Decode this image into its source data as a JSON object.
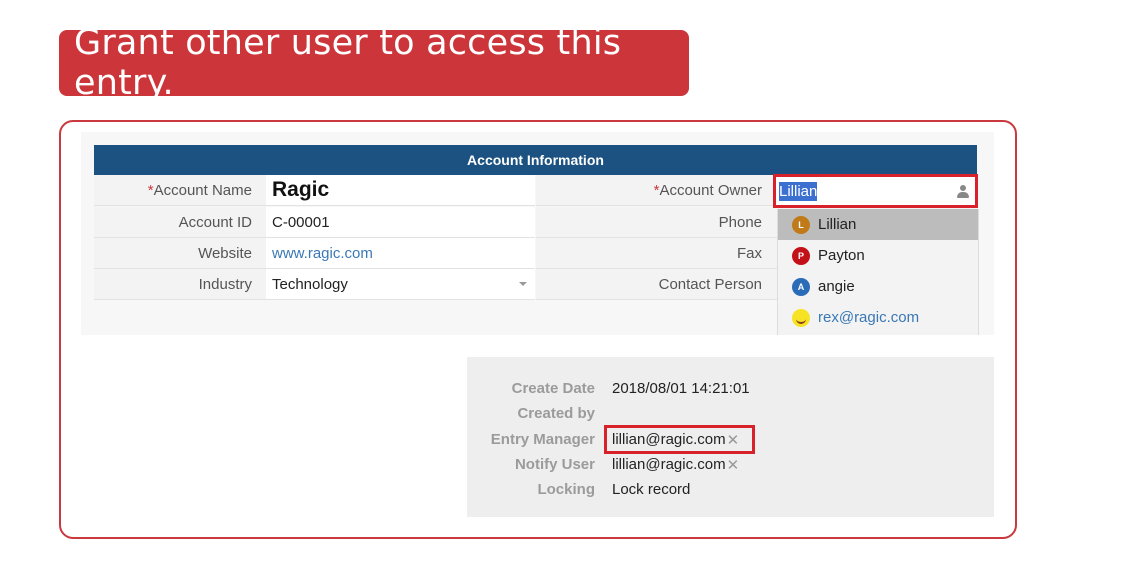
{
  "banner": {
    "title": "Grant other user to access this entry."
  },
  "form": {
    "section_title": "Account Information",
    "required_mark": "*",
    "left_fields": [
      {
        "label": "Account Name",
        "value": "Ragic",
        "required": true
      },
      {
        "label": "Account ID",
        "value": "C-00001"
      },
      {
        "label": "Website",
        "value": "www.ragic.com"
      },
      {
        "label": "Industry",
        "value": "Technology"
      }
    ],
    "right_fields": [
      {
        "label": "Account Owner",
        "value": "Lillian",
        "required": true
      },
      {
        "label": "Phone",
        "value": ""
      },
      {
        "label": "Fax",
        "value": ""
      },
      {
        "label": "Contact Person",
        "value": ""
      }
    ],
    "owner_dropdown": [
      {
        "initial": "L",
        "name": "Lillian",
        "color": "#c07a1a"
      },
      {
        "initial": "P",
        "name": "Payton",
        "color": "#c3111a"
      },
      {
        "initial": "A",
        "name": "angie",
        "color": "#2b6cb8"
      },
      {
        "initial": "",
        "name": "rex@ragic.com",
        "color": "#f7e223"
      }
    ]
  },
  "info": {
    "rows": [
      {
        "label": "Create Date",
        "value": "2018/08/01 14:21:01"
      },
      {
        "label": "Created by",
        "value": ""
      },
      {
        "label": "Entry Manager",
        "value": "lillian@ragic.com"
      },
      {
        "label": "Notify User",
        "value": "lillian@ragic.com"
      },
      {
        "label": "Locking",
        "value": "Lock record"
      }
    ],
    "remove_glyph": "✕"
  },
  "colors": {
    "accent_red": "#cc3539",
    "header_blue": "#1b5281",
    "link_blue": "#3a78b5"
  }
}
